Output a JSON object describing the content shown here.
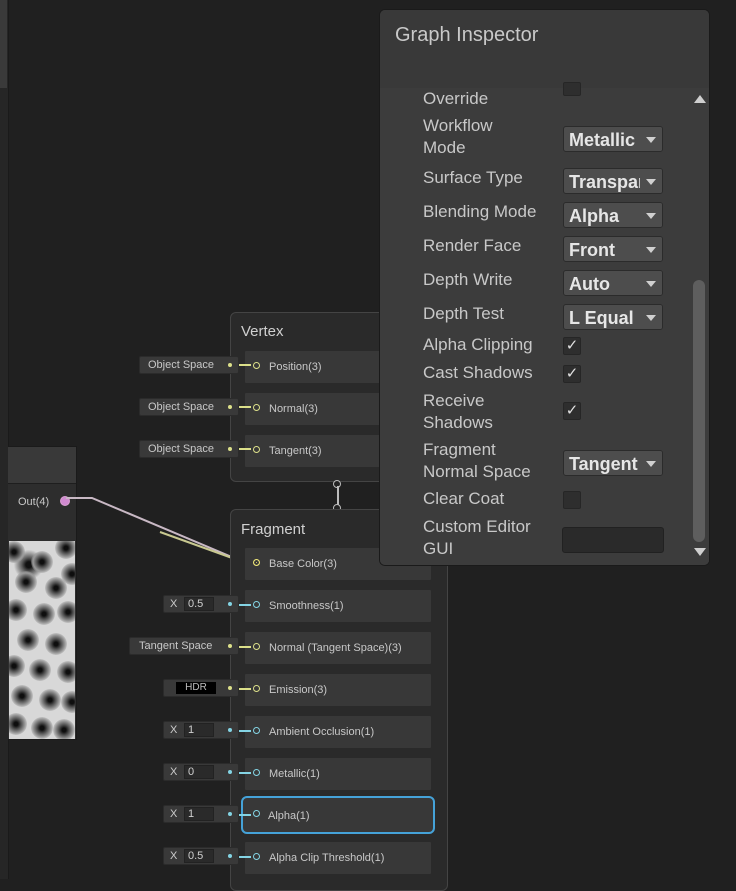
{
  "preview_node": {
    "output_label": "Out(4)"
  },
  "vertex": {
    "title": "Vertex",
    "blocks": [
      {
        "label": "Position(3)",
        "control": "Object Space"
      },
      {
        "label": "Normal(3)",
        "control": "Object Space"
      },
      {
        "label": "Tangent(3)",
        "control": "Object Space"
      }
    ]
  },
  "fragment": {
    "title": "Fragment",
    "base_color": "Base Color(3)",
    "smoothness": {
      "label": "Smoothness(1)",
      "x": "X",
      "value": "0.5"
    },
    "normal": {
      "label": "Normal (Tangent Space)(3)",
      "control": "Tangent Space"
    },
    "emission": {
      "label": "Emission(3)",
      "control": "HDR"
    },
    "ao": {
      "label": "Ambient Occlusion(1)",
      "x": "X",
      "value": "1"
    },
    "metallic": {
      "label": "Metallic(1)",
      "x": "X",
      "value": "0"
    },
    "alpha": {
      "label": "Alpha(1)",
      "x": "X",
      "value": "1"
    },
    "alpha_clip": {
      "label": "Alpha Clip Threshold(1)",
      "x": "X",
      "value": "0.5"
    }
  },
  "inspector": {
    "title": "Graph Inspector",
    "override_label": "Override",
    "workflow_mode": {
      "label_1": "Workflow",
      "label_2": "Mode",
      "value": "Metallic"
    },
    "surface_type": {
      "label": "Surface Type",
      "value": "Transparent"
    },
    "blending_mode": {
      "label": "Blending Mode",
      "value": "Alpha"
    },
    "render_face": {
      "label": "Render Face",
      "value": "Front"
    },
    "depth_write": {
      "label": "Depth Write",
      "value": "Auto"
    },
    "depth_test": {
      "label": "Depth Test",
      "value": "L Equal"
    },
    "alpha_clipping": {
      "label": "Alpha Clipping",
      "check": "✓"
    },
    "cast_shadows": {
      "label": "Cast Shadows",
      "check": "✓"
    },
    "receive_shadows": {
      "label_1": "Receive",
      "label_2": "Shadows",
      "check": "✓"
    },
    "fragment_normal_space": {
      "label_1": "Fragment",
      "label_2": "Normal Space",
      "value": "Tangent"
    },
    "clear_coat": {
      "label": "Clear Coat",
      "check": ""
    },
    "custom_editor_gui": {
      "label_1": "Custom Editor",
      "label_2": "GUI",
      "value": ""
    }
  },
  "colors": {
    "vector3_port": "#dce08a",
    "float_port": "#84d4e4",
    "color_port": "#f0e87a",
    "vector4_port": "#d08ad0",
    "selection": "#45a2d8"
  }
}
